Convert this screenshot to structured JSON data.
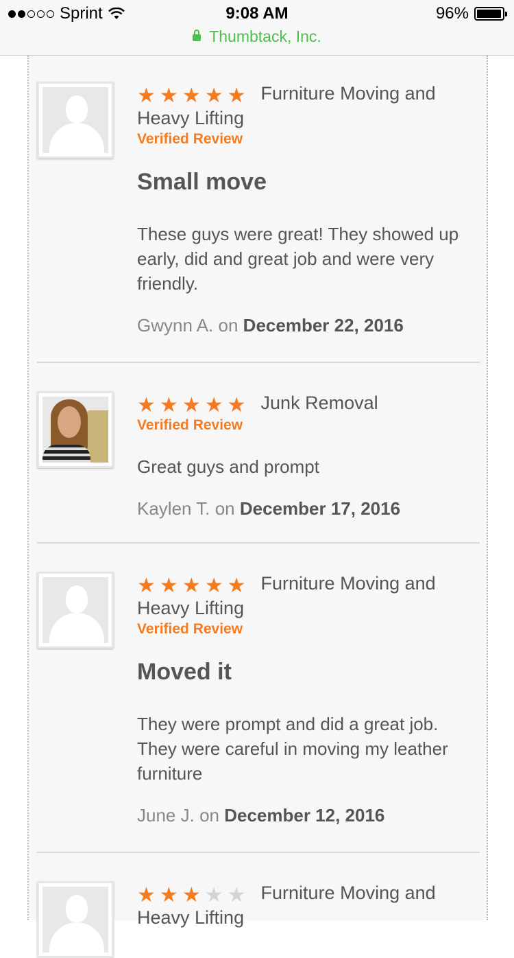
{
  "status": {
    "carrier": "Sprint",
    "time": "9:08 AM",
    "battery": "96%",
    "battery_level": 0.96,
    "url": "Thumbtack, Inc."
  },
  "reviews": [
    {
      "rating": 5,
      "category": "Furniture Moving and Heavy Lifting",
      "verified": "Verified Review",
      "title": "Small move",
      "body": "These guys were great! They showed up early, did and great job and were very friendly.",
      "author": "Gwynn A.",
      "on": "on",
      "date": "December 22, 2016",
      "avatar": "placeholder"
    },
    {
      "rating": 5,
      "category": "Junk Removal",
      "verified": "Verified Review",
      "title": "",
      "body": "Great guys and prompt",
      "author": "Kaylen T.",
      "on": "on",
      "date": "December 17, 2016",
      "avatar": "photo"
    },
    {
      "rating": 5,
      "category": "Furniture Moving and Heavy Lifting",
      "verified": "Verified Review",
      "title": "Moved it",
      "body": "They were prompt and did a great job. They were careful in moving my leather furniture",
      "author": "June J.",
      "on": "on",
      "date": "December 12, 2016",
      "avatar": "placeholder"
    },
    {
      "rating": 3,
      "category": "Furniture Moving and Heavy Lifting",
      "avatar": "placeholder"
    }
  ],
  "colors": {
    "accent": "#f47b20",
    "secure": "#4cbf4c",
    "text": "#555555"
  }
}
